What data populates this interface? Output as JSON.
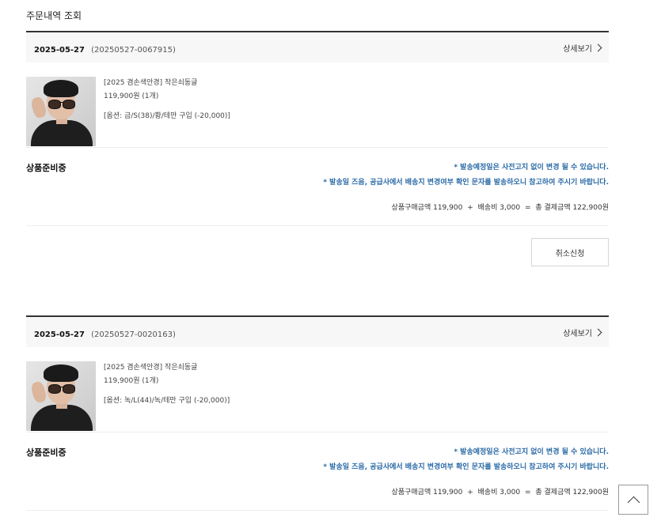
{
  "page": {
    "title": "주문내역 조회"
  },
  "orders": [
    {
      "date": "2025-05-27",
      "order_no": "(20250527-0067915)",
      "detail_label": "상세보기",
      "product": {
        "name": "[2025 겸손색안경] 작은쇠동글",
        "price_qty": "119,900원 (1개)",
        "option": "[옵션: 금/S(38)/황/테만 구입 (-20,000)]"
      },
      "status": "상품준비중",
      "note1": "* 발송예정일은 사전고지 없이 변경 될 수 있습니다.",
      "note2": "* 발송일 즈음, 공급사에서 배송지 변경여부 확인 문자를 발송하오니 참고하여 주시기 바랍니다.",
      "summary": {
        "product_amount": "상품구매금액 119,900",
        "plus": "+",
        "shipping": "배송비 3,000",
        "equals": "=",
        "total": "총 결제금액 122,900원"
      },
      "cancel_label": "취소신청"
    },
    {
      "date": "2025-05-27",
      "order_no": "(20250527-0020163)",
      "detail_label": "상세보기",
      "product": {
        "name": "[2025 겸손색안경] 작은쇠동글",
        "price_qty": "119,900원 (1개)",
        "option": "[옵션: 녹/L(44)/녹/테만 구입 (-20,000)]"
      },
      "status": "상품준비중",
      "note1": "* 발송예정일은 사전고지 없이 변경 될 수 있습니다.",
      "note2": "* 발송일 즈음, 공급사에서 배송지 변경여부 확인 문자를 발송하오니 참고하여 주시기 바랍니다.",
      "summary": {
        "product_amount": "상품구매금액 119,900",
        "plus": "+",
        "shipping": "배송비 3,000",
        "equals": "=",
        "total": "총 결제금액 122,900원"
      }
    }
  ],
  "icons": {
    "detail": "chevron-right-icon",
    "top": "chevron-up-icon"
  },
  "colors": {
    "note": "#2a6aa6",
    "header_border": "#333333",
    "header_bg": "#f7f7f7"
  }
}
